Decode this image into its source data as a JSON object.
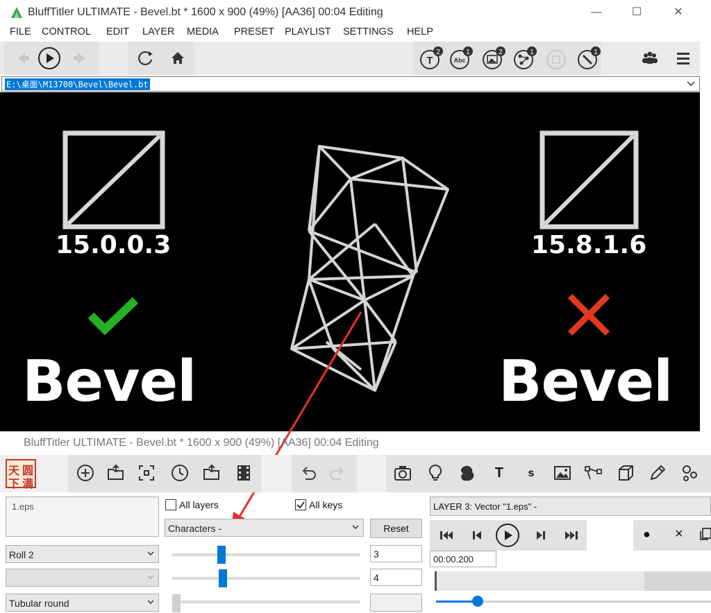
{
  "window": {
    "title": "BluffTitler ULTIMATE  - Bevel.bt * 1600 x 900 (49%) [AA36] 00:04 Editing",
    "minimize": "—",
    "maximize": "☐",
    "close": "✕"
  },
  "menu": [
    "FILE",
    "CONTROL",
    "EDIT",
    "LAYER",
    "MEDIA",
    "PRESET",
    "PLAYLIST",
    "SETTINGS",
    "HELP"
  ],
  "toolbar": {
    "badges": [
      "2",
      "1",
      "2",
      "1",
      "1"
    ],
    "text_icon_label": "T",
    "abc_icon_label": "Abc"
  },
  "path": "E:\\桌面\\M13700\\Bevel\\Bevel.bt",
  "canvas": {
    "left_version": "15.0.0.3",
    "right_version": "15.8.1.6",
    "left_word": "Bevel",
    "right_word": "Bevel",
    "check_color": "#22b322",
    "cross_color": "#e03a1e",
    "arrow_color": "#e8302a"
  },
  "window2": {
    "title": "BluffTitler ULTIMATE  - Bevel.bt * 1600 x 900 (49%) [AA36] 00:04 Editing",
    "logo_text": [
      "天",
      "圆",
      "下",
      "满"
    ]
  },
  "toolbar2": {
    "text_label": "T",
    "s_label": "s"
  },
  "panel": {
    "media_field": "1.eps",
    "all_layers_label": "All layers",
    "all_keys_label": "All keys",
    "all_layers_checked": false,
    "all_keys_checked": true,
    "characters_select": "Characters -",
    "reset_label": "Reset",
    "roll_select": "Roll 2",
    "empty_select": "",
    "style_select": "Tubular round",
    "value1": "3",
    "value2": "4",
    "slider1_fraction": 0.25,
    "slider2_fraction": 0.26,
    "layer_label": "LAYER 3: Vector \"1.eps\" -",
    "time": "00:00.200",
    "record_label": "●",
    "delete_label": "×"
  }
}
